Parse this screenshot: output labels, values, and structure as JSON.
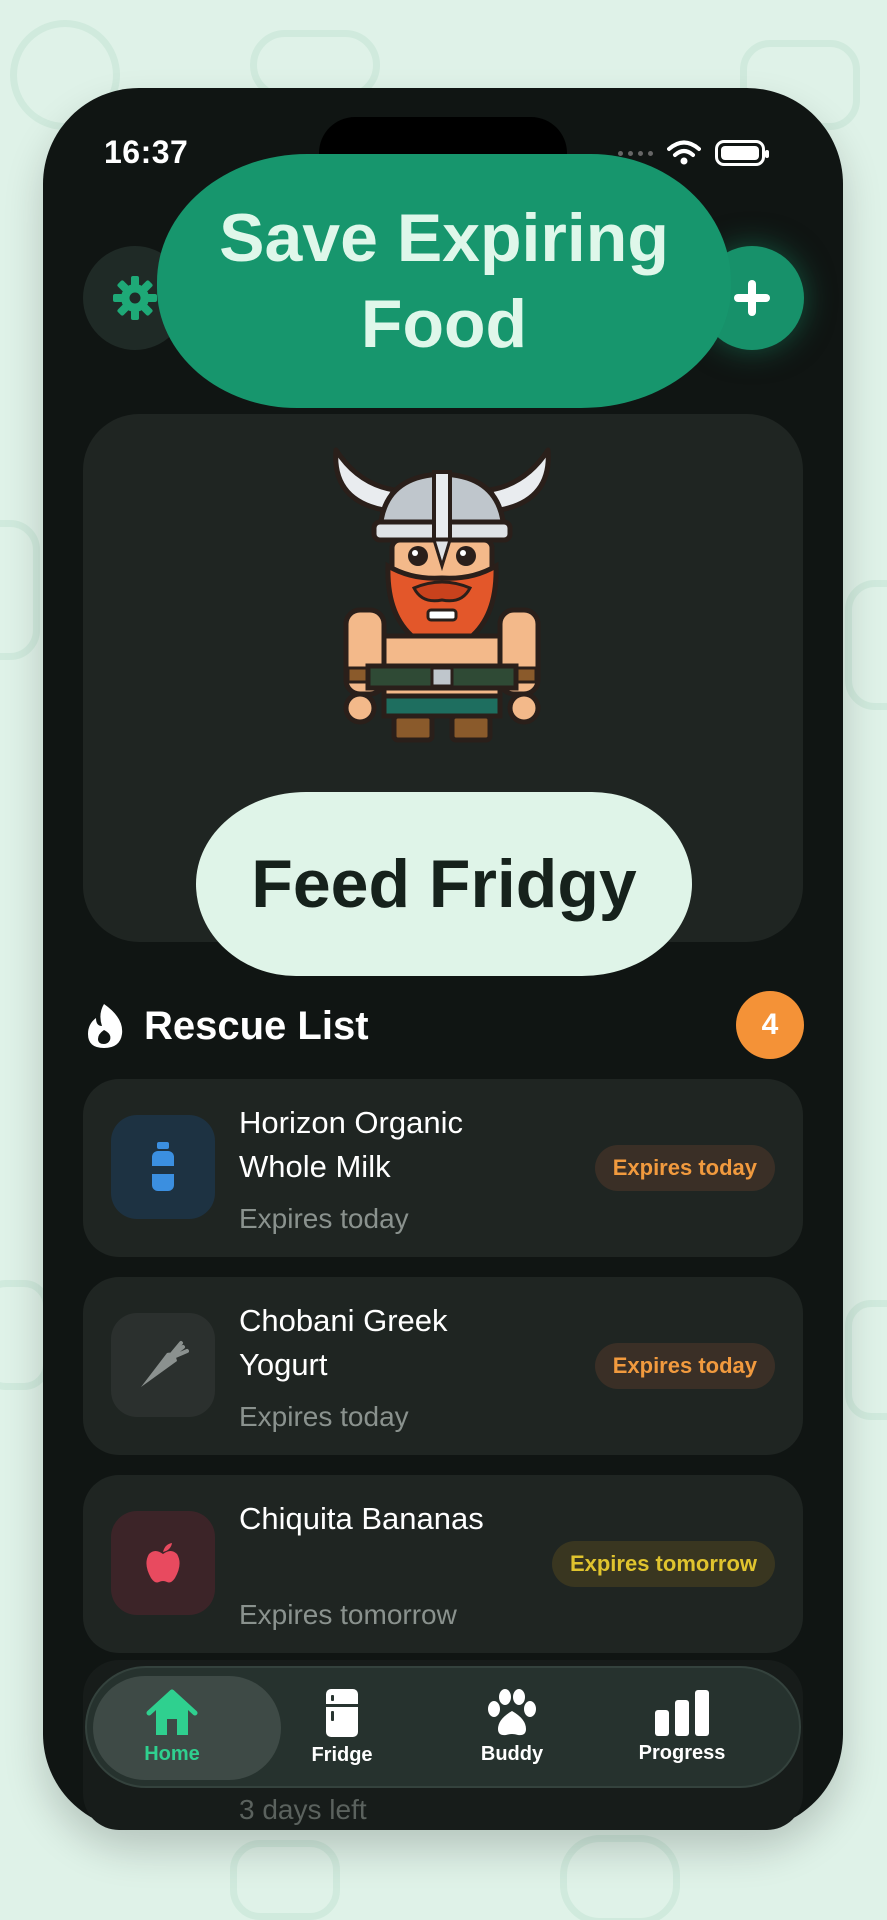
{
  "status_bar": {
    "time": "16:37"
  },
  "header": {
    "title": "Save Expiring Food"
  },
  "hero": {
    "button_label": "Feed Fridgy"
  },
  "rescue": {
    "title": "Rescue List",
    "count": "4",
    "items": [
      {
        "name": "Horizon Organic Whole Milk",
        "subtitle": "Expires today",
        "tag": "Expires today",
        "icon": "milk-bottle-icon",
        "icon_color": "#3b8fe0",
        "icon_bg": "#1d3242"
      },
      {
        "name": "Chobani Greek Yogurt",
        "subtitle": "Expires today",
        "tag": "Expires today",
        "icon": "carrot-icon",
        "icon_color": "#8b918f",
        "icon_bg": "#2b302e"
      },
      {
        "name": "Chiquita Bananas",
        "subtitle": "Expires tomorrow",
        "tag": "Expires tomorrow",
        "icon": "apple-icon",
        "icon_color": "#e84a5f",
        "icon_bg": "#3c2428"
      }
    ],
    "partial_item_subtitle": "3 days left"
  },
  "tabbar": {
    "tabs": [
      {
        "label": "Home",
        "icon": "house-icon",
        "active": true
      },
      {
        "label": "Fridge",
        "icon": "fridge-icon"
      },
      {
        "label": "Buddy",
        "icon": "paw-icon"
      },
      {
        "label": "Progress",
        "icon": "bar-chart-icon"
      }
    ]
  },
  "colors": {
    "accent": "#17966d",
    "badge": "#f49237",
    "background": "#101513"
  }
}
